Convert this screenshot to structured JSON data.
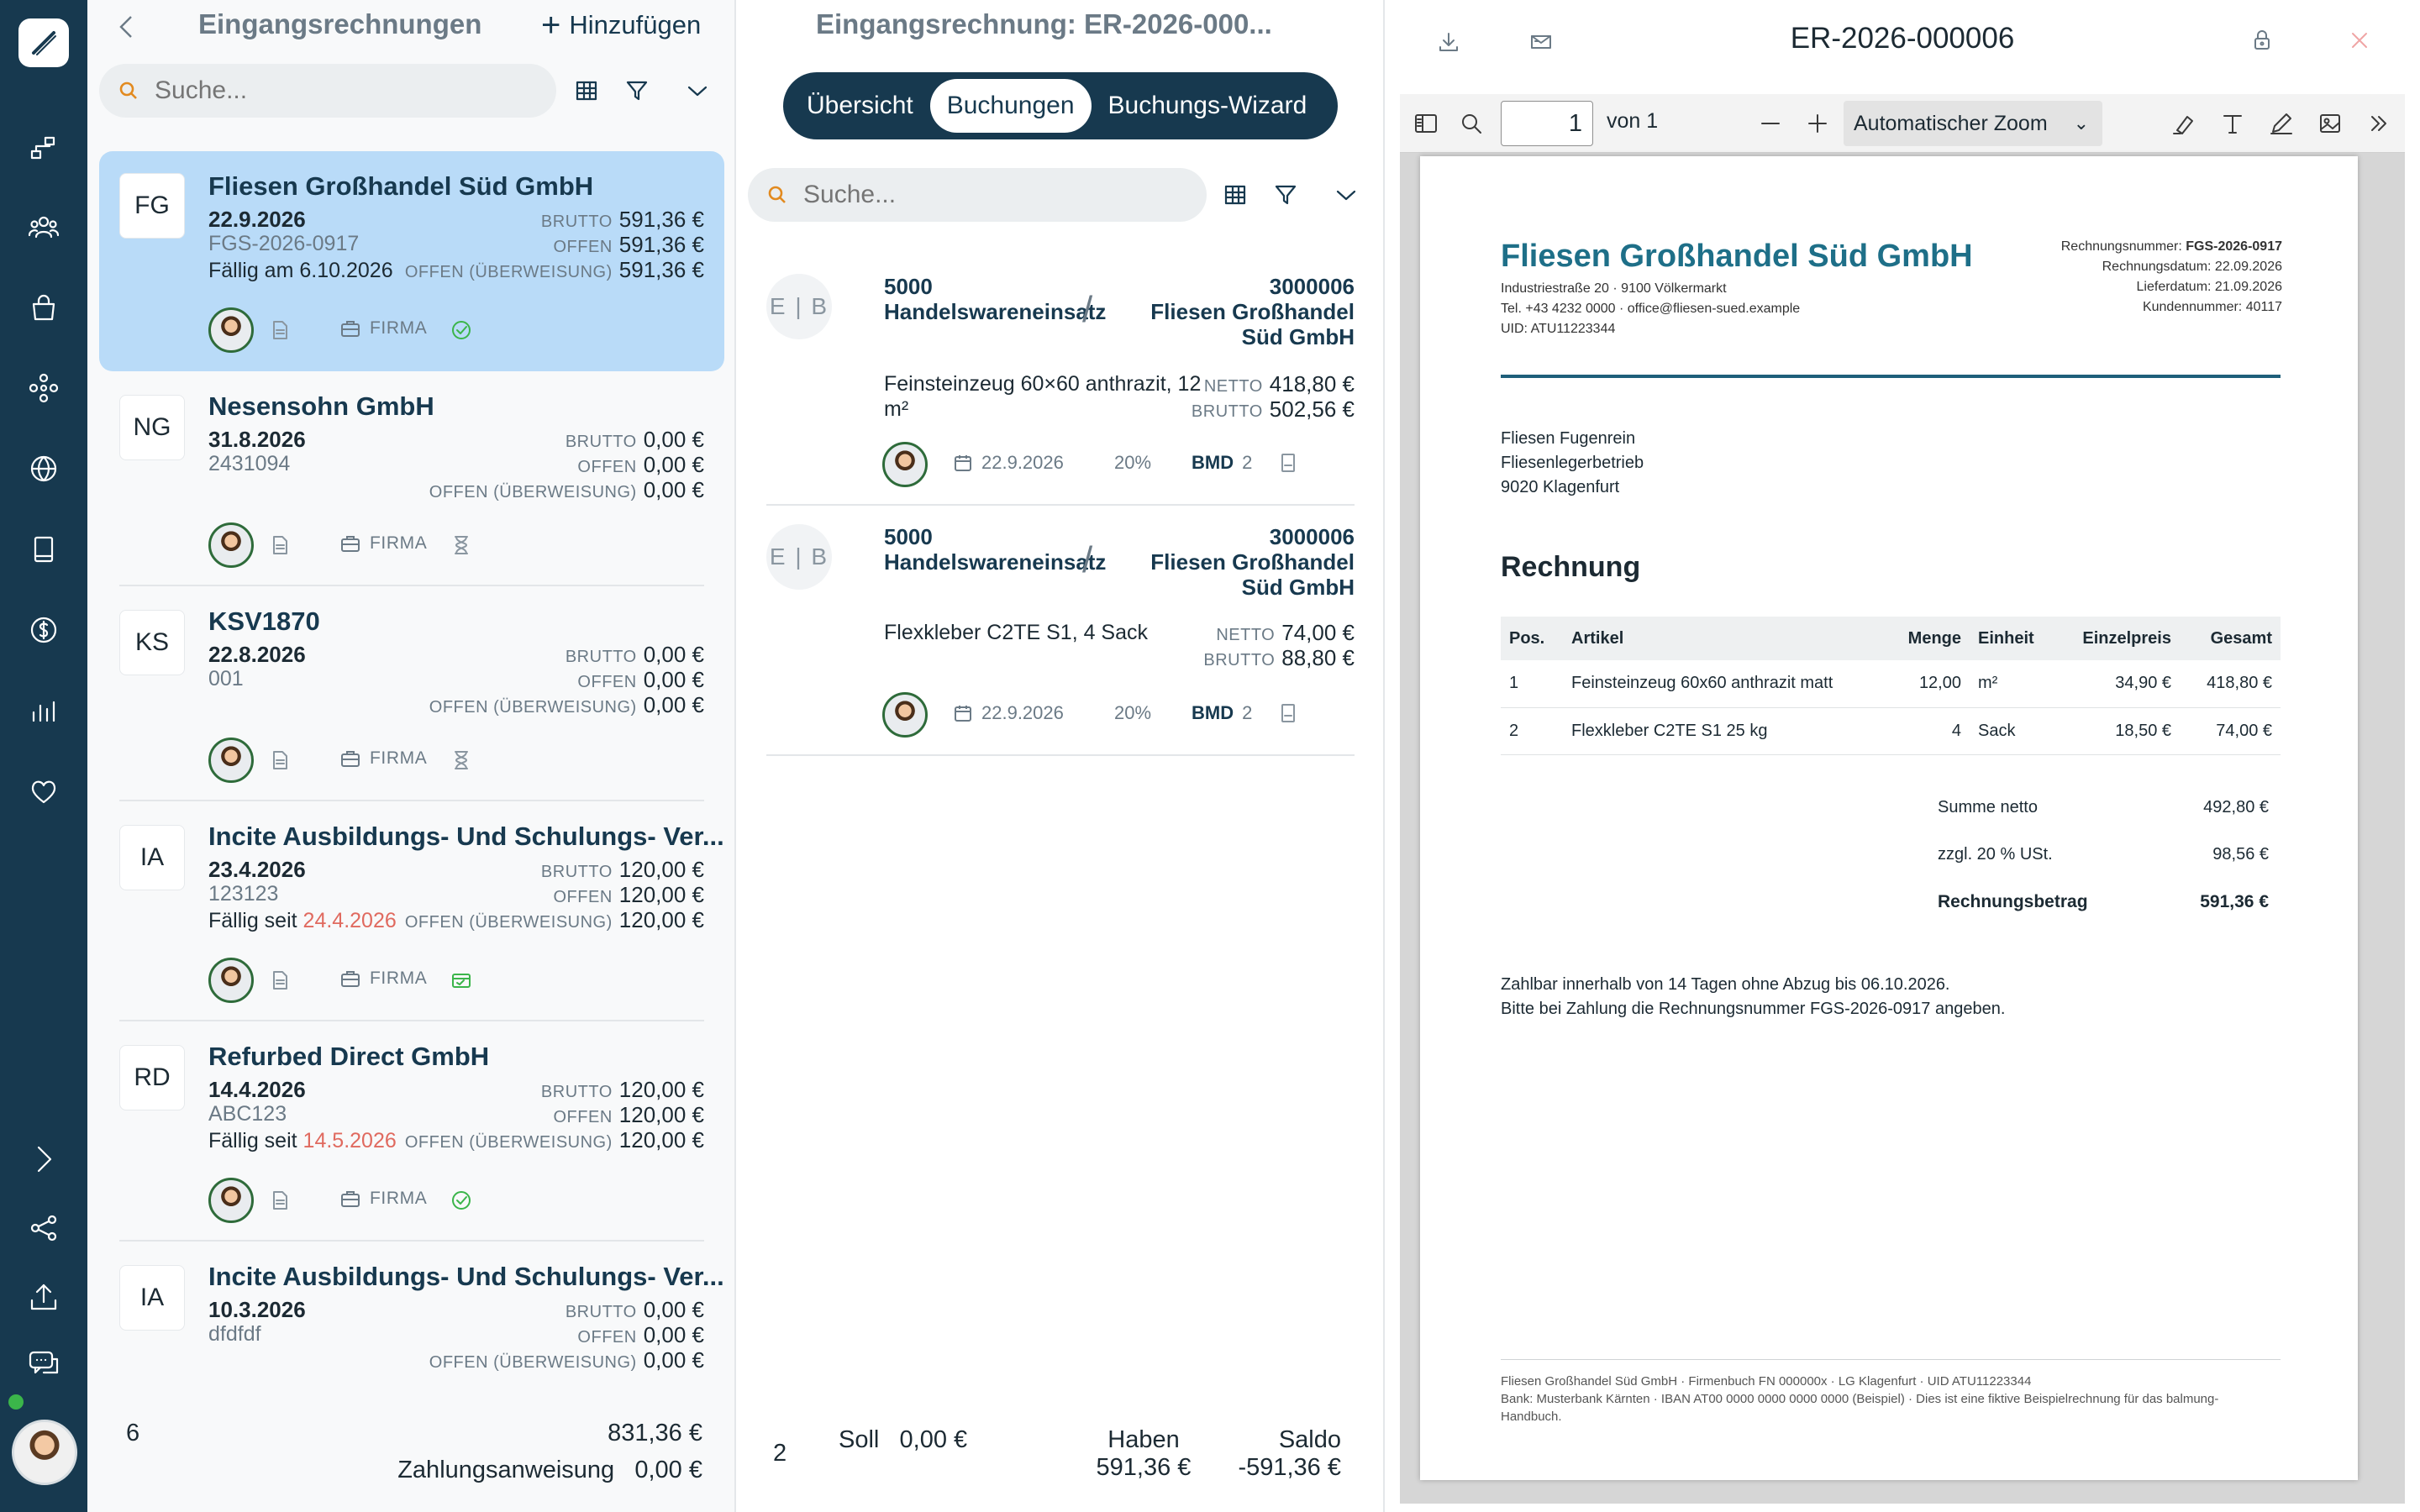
{
  "sidebar": {
    "items": [
      "logo-icon",
      "flow-icon",
      "users-icon",
      "bag-icon",
      "network-icon",
      "globe-icon",
      "book-icon",
      "dollar-icon",
      "chart-icon",
      "heart-icon",
      "chevron-right-icon",
      "share-icon",
      "upload-icon",
      "chat-icon"
    ]
  },
  "list": {
    "title": "Eingangsrechnungen",
    "add_label": "Hinzufügen",
    "search_placeholder": "Suche...",
    "labels": {
      "brutto": "BRUTTO",
      "offen": "OFFEN",
      "ueberweisung": "OFFEN (ÜBERWEISUNG)",
      "firma": "FIRMA"
    },
    "cards": [
      {
        "initials": "FG",
        "name": "Fliesen Großhandel Süd GmbH",
        "date": "22.9.2026",
        "number": "FGS-2026-0917",
        "due_prefix": "Fällig am ",
        "due_date": "6.10.2026",
        "brutto": "591,36 €",
        "offen": "591,36 €",
        "ueberweisung": "591,36 €"
      },
      {
        "initials": "NG",
        "name": "Nesensohn GmbH",
        "date": "31.8.2026",
        "number": "2431094",
        "due_prefix": "",
        "due_date": "",
        "brutto": "0,00 €",
        "offen": "0,00 €",
        "ueberweisung": "0,00 €"
      },
      {
        "initials": "KS",
        "name": "KSV1870",
        "date": "22.8.2026",
        "number": "001",
        "due_prefix": "",
        "due_date": "",
        "brutto": "0,00 €",
        "offen": "0,00 €",
        "ueberweisung": "0,00 €"
      },
      {
        "initials": "IA",
        "name": "Incite Ausbildungs- Und Schulungs- Ver...",
        "date": "23.4.2026",
        "number": "123123",
        "due_prefix": "Fällig seit ",
        "due_date": "24.4.2026",
        "brutto": "120,00 €",
        "offen": "120,00 €",
        "ueberweisung": "120,00 €"
      },
      {
        "initials": "RD",
        "name": "Refurbed Direct GmbH",
        "date": "14.4.2026",
        "number": "ABC123",
        "due_prefix": "Fällig seit ",
        "due_date": "14.5.2026",
        "brutto": "120,00 €",
        "offen": "120,00 €",
        "ueberweisung": "120,00 €"
      },
      {
        "initials": "IA",
        "name": "Incite Ausbildungs- Und Schulungs- Ver...",
        "date": "10.3.2026",
        "number": "dfdfdf",
        "due_prefix": "",
        "due_date": "",
        "brutto": "0,00 €",
        "offen": "0,00 €",
        "ueberweisung": "0,00 €"
      }
    ],
    "footer": {
      "count": "6",
      "total": "831,36 €",
      "payment_label": "Zahlungsanweisung",
      "payment_value": "0,00 €"
    }
  },
  "detail": {
    "title": "Eingangsrechnung: ER-2026-000...",
    "tabs": [
      "Übersicht",
      "Buchungen",
      "Buchungs-Wizard"
    ],
    "active_tab": "Buchungen",
    "search_placeholder": "Suche...",
    "eb": "E | B",
    "labels": {
      "netto": "NETTO",
      "brutto": "BRUTTO",
      "bmd": "BMD"
    },
    "bookings": [
      {
        "debit_account": "5000",
        "debit_name": "Handelswareneinsatz",
        "credit_account": "3000006",
        "credit_name_1": "Fliesen Großhandel",
        "credit_name_2": "Süd GmbH",
        "description": "Feinsteinzeug 60×60 anthrazit, 12 m²",
        "netto": "418,80 €",
        "brutto": "502,56 €",
        "date": "22.9.2026",
        "tax": "20%",
        "bmd_count": "2"
      },
      {
        "debit_account": "5000",
        "debit_name": "Handelswareneinsatz",
        "credit_account": "3000006",
        "credit_name_1": "Fliesen Großhandel",
        "credit_name_2": "Süd GmbH",
        "description": "Flexkleber C2TE S1, 4 Sack",
        "netto": "74,00 €",
        "brutto": "88,80 €",
        "date": "22.9.2026",
        "tax": "20%",
        "bmd_count": "2"
      }
    ],
    "footer": {
      "count": "2",
      "soll_label": "Soll",
      "soll_value": "0,00 €",
      "haben_label": "Haben",
      "haben_value": "591,36 €",
      "saldo_label": "Saldo",
      "saldo_value": "-591,36 €"
    }
  },
  "viewer": {
    "title": "ER-2026-000006",
    "page_value": "1",
    "page_of": "von 1",
    "zoom_label": "Automatischer Zoom",
    "invoice": {
      "company": "Fliesen Großhandel Süd GmbH",
      "address": "Industriestraße 20 · 9100 Völkermarkt",
      "contact": "Tel. +43 4232 0000 · office@fliesen-sued.example",
      "uid": "UID: ATU11223344",
      "meta": [
        {
          "label": "Rechnungsnummer: ",
          "value": "FGS-2026-0917"
        },
        {
          "label": "Rechnungsdatum: ",
          "value": "22.09.2026"
        },
        {
          "label": "Lieferdatum: ",
          "value": "21.09.2026"
        },
        {
          "label": "Kundennummer: ",
          "value": "40117"
        }
      ],
      "recipient": [
        "Fliesen Fugenrein",
        "Fliesenlegerbetrieb",
        "9020 Klagenfurt"
      ],
      "heading": "Rechnung",
      "columns": [
        "Pos.",
        "Artikel",
        "Menge",
        "Einheit",
        "Einzelpreis",
        "Gesamt"
      ],
      "rows": [
        [
          "1",
          "Feinsteinzeug 60x60 anthrazit matt",
          "12,00",
          "m²",
          "34,90 €",
          "418,80 €"
        ],
        [
          "2",
          "Flexkleber C2TE S1 25 kg",
          "4",
          "Sack",
          "18,50 €",
          "74,00 €"
        ]
      ],
      "sum_netto_label": "Summe netto",
      "sum_netto": "492,80 €",
      "vat_label": "zzgl. 20 % USt.",
      "vat": "98,56 €",
      "total_label": "Rechnungsbetrag",
      "total": "591,36 €",
      "payment_terms_1": "Zahlbar innerhalb von 14 Tagen ohne Abzug bis 06.10.2026.",
      "payment_terms_2": "Bitte bei Zahlung die Rechnungsnummer FGS-2026-0917 angeben.",
      "footer_1": "Fliesen Großhandel Süd GmbH · Firmenbuch FN 000000x · LG Klagenfurt · UID ATU11223344",
      "footer_2": "Bank: Musterbank Kärnten · IBAN AT00 0000 0000 0000 0000 (Beispiel) · Dies ist eine fiktive Beispielrechnung für das balmung-",
      "footer_3": "Handbuch."
    }
  },
  "colors": {
    "sidebar": "#17394f",
    "accent": "#17394f",
    "selected": "#b9dbf8",
    "overdue": "#e06a5f",
    "ok": "#3bb54a"
  }
}
